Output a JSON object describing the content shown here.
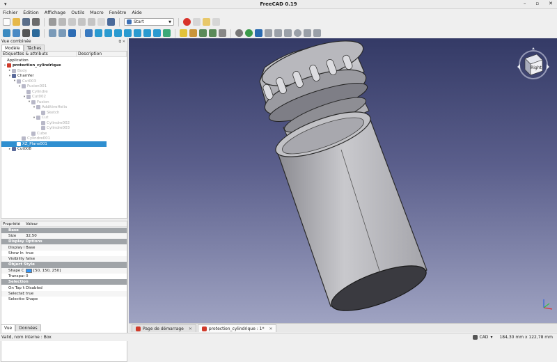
{
  "window": {
    "title": "FreeCAD 0.19",
    "menu_glyph": "▾",
    "minimize": "–",
    "maximize": "▫",
    "close": "✕"
  },
  "menu": [
    "Fichier",
    "Édition",
    "Affichage",
    "Outils",
    "Macro",
    "Fenêtre",
    "Aide"
  ],
  "workbench": {
    "selected": "Start"
  },
  "combo_view": {
    "title": "Vue combinée",
    "tabs": [
      "Modèle",
      "Tâches"
    ],
    "columns": [
      "Étiquettes & attributs",
      "Description"
    ],
    "tree": [
      {
        "label": "Application",
        "depth": 0,
        "twist": "",
        "style": ""
      },
      {
        "label": "protection_cylindrique",
        "depth": 0,
        "twist": "▾",
        "style": "bold"
      },
      {
        "label": "Body",
        "depth": 1,
        "twist": "▸",
        "style": "dim"
      },
      {
        "label": "Chamfer",
        "depth": 1,
        "twist": "▾",
        "style": ""
      },
      {
        "label": "Cut003",
        "depth": 2,
        "twist": "▾",
        "style": "dim"
      },
      {
        "label": "Fusion001",
        "depth": 3,
        "twist": "▾",
        "style": "dim"
      },
      {
        "label": "Cylindre",
        "depth": 4,
        "twist": "",
        "style": "dim"
      },
      {
        "label": "Cut002",
        "depth": 4,
        "twist": "▾",
        "style": "dim"
      },
      {
        "label": "Fusion",
        "depth": 5,
        "twist": "▾",
        "style": "dim"
      },
      {
        "label": "AdditiveHelix",
        "depth": 6,
        "twist": "▾",
        "style": "dim"
      },
      {
        "label": "Sketch",
        "depth": 7,
        "twist": "",
        "style": "dim"
      },
      {
        "label": "Cut",
        "depth": 6,
        "twist": "▾",
        "style": "dim"
      },
      {
        "label": "Cylindre002",
        "depth": 7,
        "twist": "",
        "style": "dim"
      },
      {
        "label": "Cylindre003",
        "depth": 7,
        "twist": "",
        "style": "dim"
      },
      {
        "label": "Cube",
        "depth": 5,
        "twist": "",
        "style": "dim"
      },
      {
        "label": "Cylindre001",
        "depth": 3,
        "twist": "",
        "style": "dim"
      },
      {
        "label": "XZ_Plane001",
        "depth": 2,
        "twist": "",
        "style": "sel"
      },
      {
        "label": "Cut008",
        "depth": 1,
        "twist": "▸",
        "style": ""
      }
    ],
    "property_columns": [
      "Propriété",
      "Valeur"
    ],
    "properties": [
      {
        "group": "Base"
      },
      {
        "name": "Size",
        "value": "32,50"
      },
      {
        "group": "Display Options"
      },
      {
        "name": "Display M...",
        "value": "Base"
      },
      {
        "name": "Show In Tr...",
        "value": "true"
      },
      {
        "name": "Visibility",
        "value": "false"
      },
      {
        "group": "Object Style"
      },
      {
        "name": "Shape Color",
        "value": "[50, 150, 250]",
        "swatch": "#3296fa"
      },
      {
        "name": "Transpare...",
        "value": "0"
      },
      {
        "group": "Selection"
      },
      {
        "name": "On Top W...",
        "value": "Disabled"
      },
      {
        "name": "Selectable",
        "value": "true"
      },
      {
        "name": "Selection ...",
        "value": "Shape"
      }
    ],
    "bottom_tabs": [
      "Vue",
      "Données"
    ]
  },
  "navcube": {
    "face_label": "Right"
  },
  "documents": [
    {
      "label": "Page de démarrage",
      "active": false
    },
    {
      "label": "protection_cylindrique : 1*",
      "active": true
    }
  ],
  "status": {
    "message": "Valid, nom interne : Box",
    "nav_style": "CAD",
    "dimensions": "184,30 mm x 122,78 mm"
  },
  "colors": {
    "selection": "#2f8fd0",
    "group_header": "#a0a4a8",
    "shape_color": "#3296fa"
  }
}
